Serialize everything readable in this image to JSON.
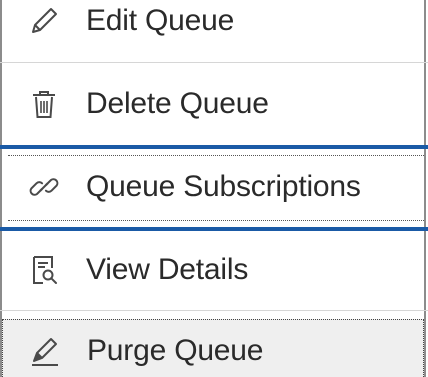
{
  "menu": {
    "items": [
      {
        "label": "Edit Queue",
        "icon": "pencil-icon"
      },
      {
        "label": "Delete Queue",
        "icon": "trash-icon"
      },
      {
        "label": "Queue Subscriptions",
        "icon": "link-icon"
      },
      {
        "label": "View Details",
        "icon": "document-search-icon"
      },
      {
        "label": "Purge Queue",
        "icon": "eraser-icon"
      }
    ],
    "highlight_color": "#1a5aa6",
    "hover_background": "#efefef"
  }
}
